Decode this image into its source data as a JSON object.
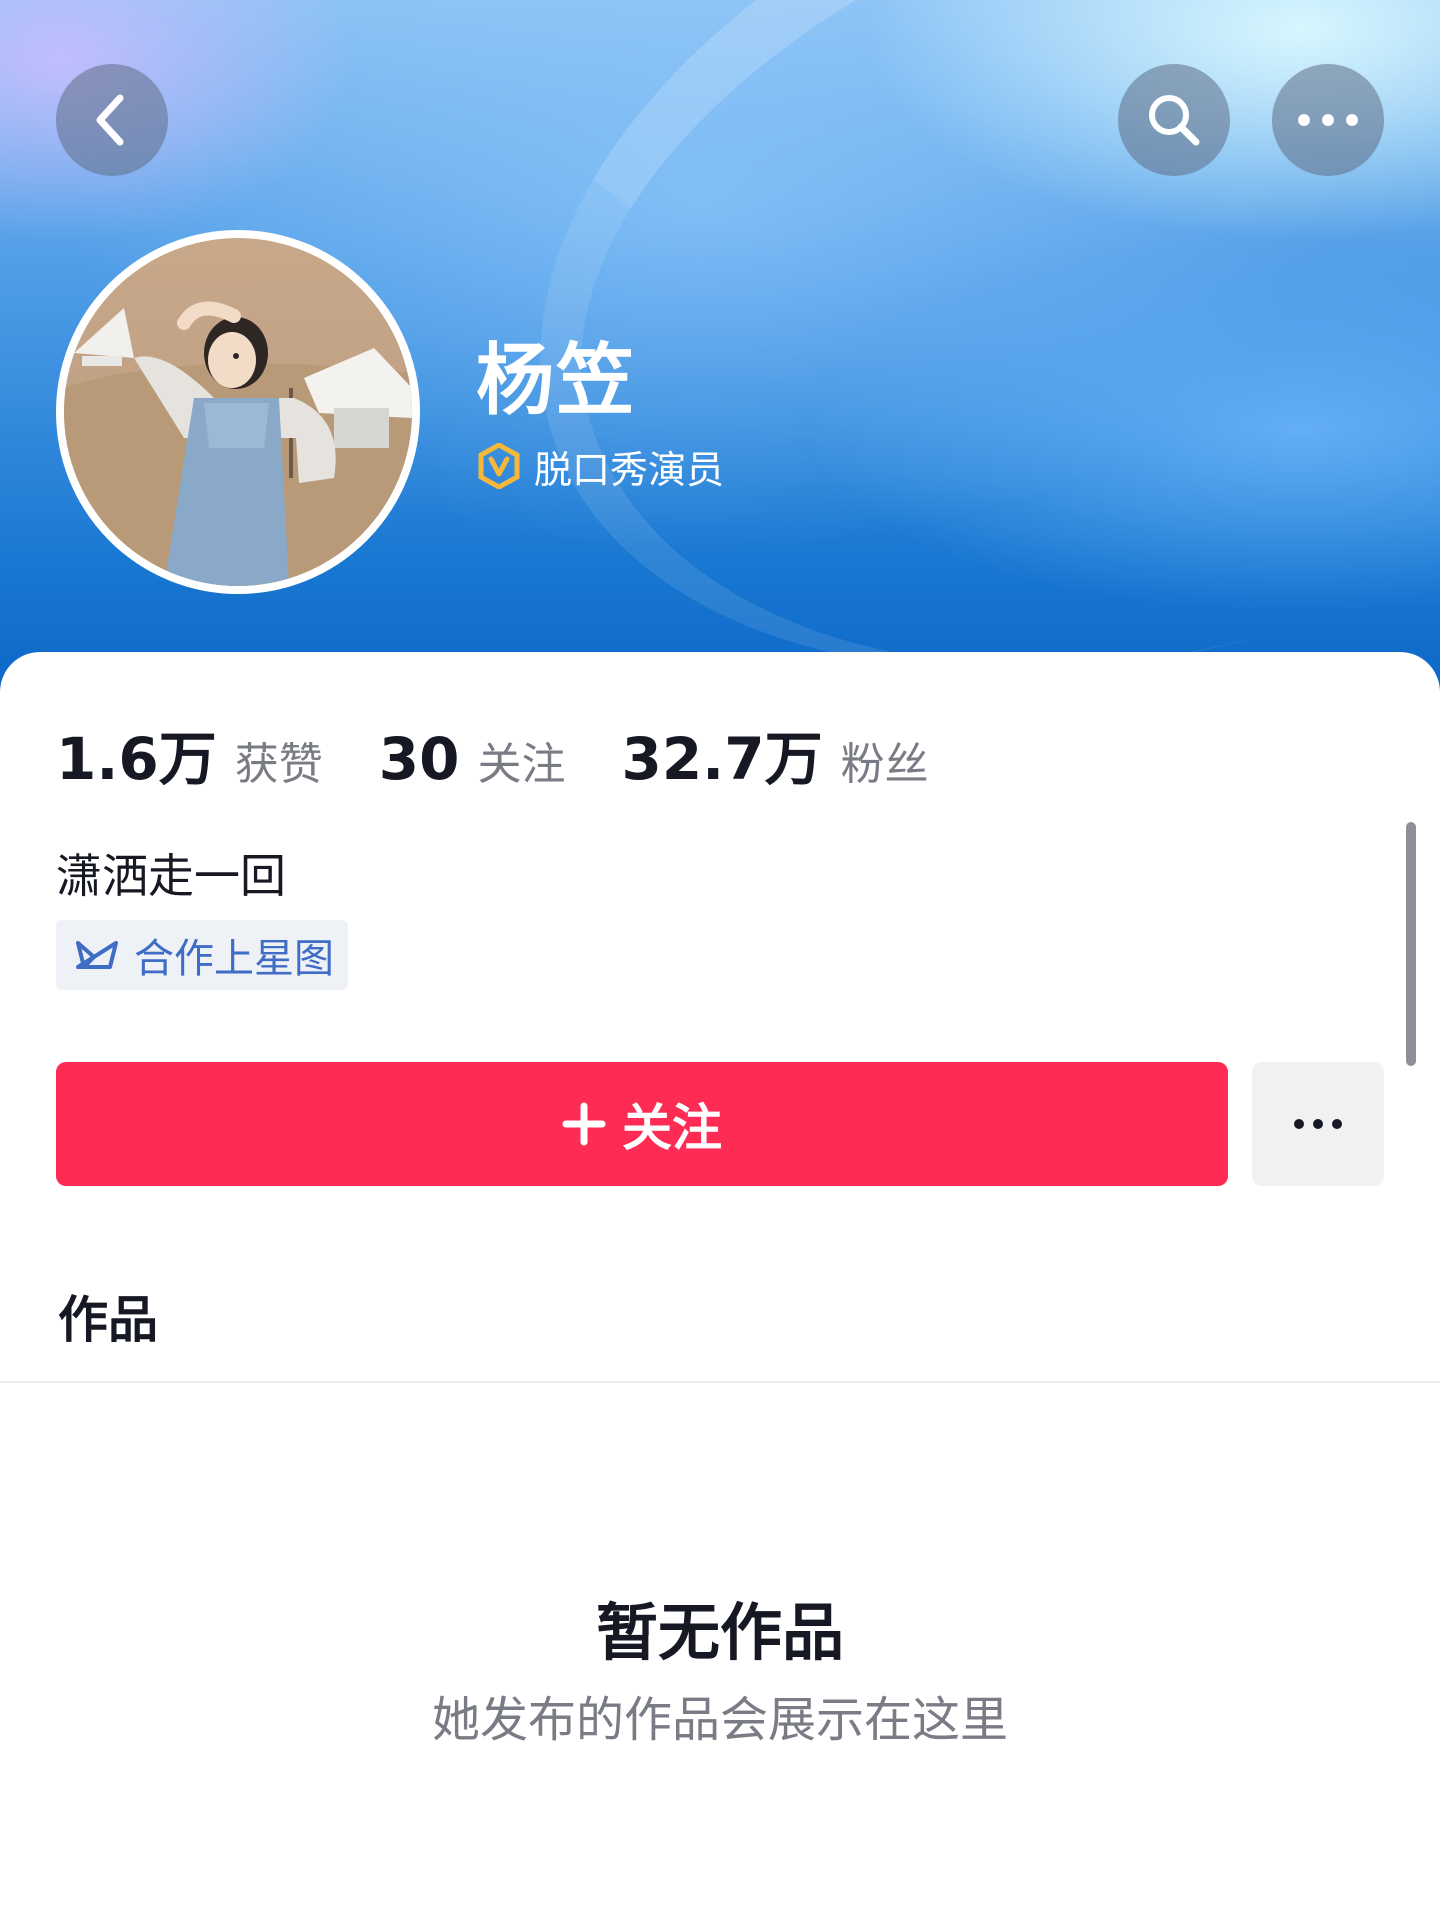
{
  "header": {
    "back_icon": "chevron-left-icon",
    "search_icon": "search-icon",
    "more_icon": "ellipsis-icon"
  },
  "profile": {
    "name": "杨笠",
    "verify_icon": "verified-v-icon",
    "verify_color": "#f5b83a",
    "title": "脱口秀演员"
  },
  "stats": [
    {
      "value": "1.6万",
      "label": "获赞"
    },
    {
      "value": "30",
      "label": "关注"
    },
    {
      "value": "32.7万",
      "label": "粉丝"
    }
  ],
  "bio": "潇洒走一回",
  "tag": {
    "icon": "star-map-icon",
    "label": "合作上星图"
  },
  "actions": {
    "follow_label": "关注",
    "follow_color": "#fe2c55",
    "more_icon": "ellipsis-icon"
  },
  "section": {
    "title": "作品"
  },
  "empty": {
    "title": "暂无作品",
    "subtitle": "她发布的作品会展示在这里"
  }
}
